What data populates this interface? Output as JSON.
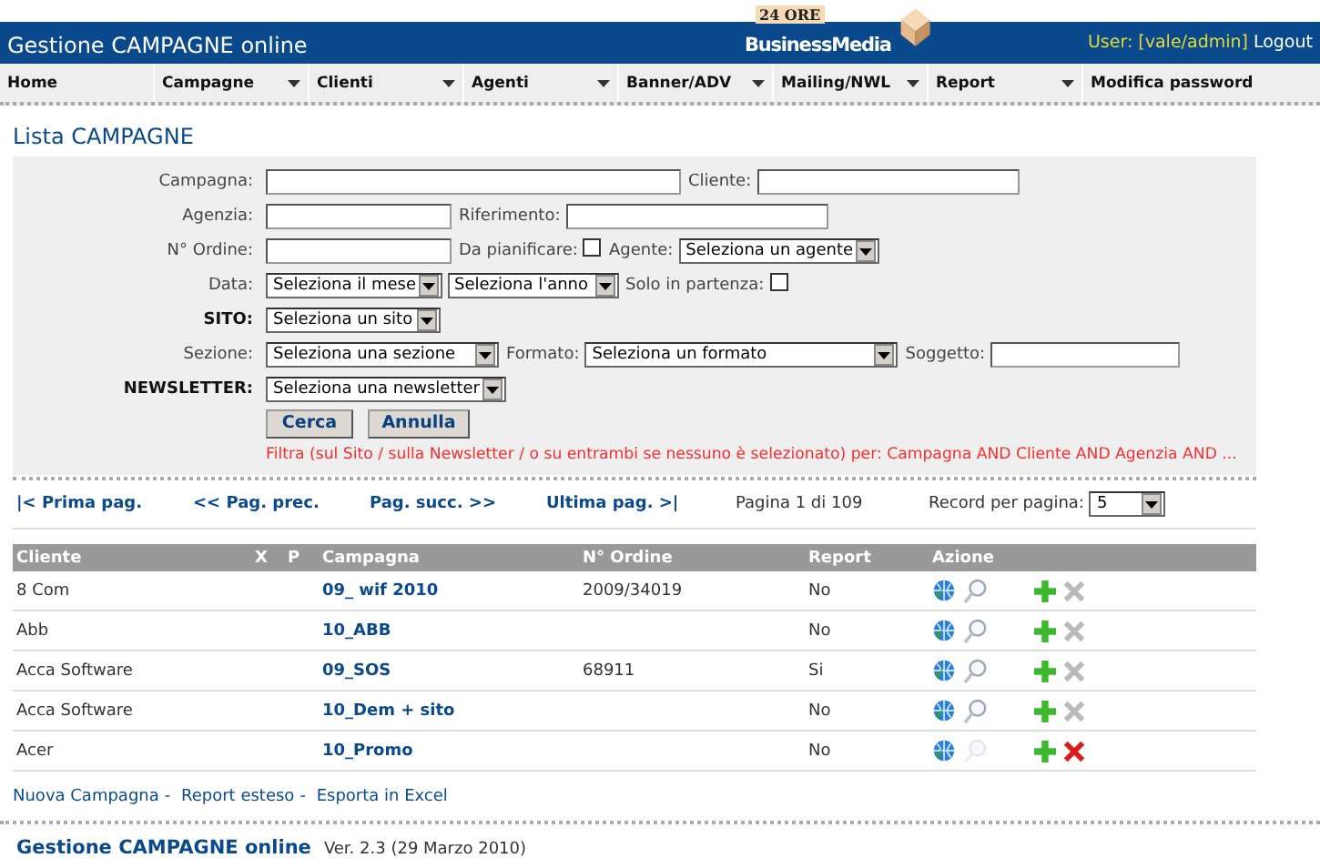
{
  "header": {
    "title": "Gestione CAMPAGNE online",
    "logo_top": "24 ORE",
    "logo_bottom": "BusinessMedia",
    "user_label": "User:",
    "user": "[vale/admin]",
    "logout": "Logout"
  },
  "menu": [
    {
      "label": "Home",
      "dropdown": false
    },
    {
      "label": "Campagne",
      "dropdown": true
    },
    {
      "label": "Clienti",
      "dropdown": true
    },
    {
      "label": "Agenti",
      "dropdown": true
    },
    {
      "label": "Banner/ADV",
      "dropdown": true
    },
    {
      "label": "Mailing/NWL",
      "dropdown": true
    },
    {
      "label": "Report",
      "dropdown": true
    },
    {
      "label": "Modifica password",
      "dropdown": false
    }
  ],
  "page_title": "Lista CAMPAGNE",
  "form": {
    "rows": [
      {
        "label": "Campagna:",
        "bold": false,
        "items": [
          {
            "kind": "input"
          },
          {
            "kind": "text",
            "text": "Cliente:"
          },
          {
            "kind": "input"
          }
        ]
      },
      {
        "label": "Agenzia:",
        "bold": false,
        "items": [
          {
            "kind": "input"
          },
          {
            "kind": "text",
            "text": "Riferimento:"
          },
          {
            "kind": "input"
          }
        ]
      },
      {
        "label": "N° Ordine:",
        "bold": false,
        "items": [
          {
            "kind": "input"
          },
          {
            "kind": "text",
            "text": "Da pianificare:"
          },
          {
            "kind": "checkbox",
            "checked": false
          },
          {
            "kind": "text",
            "text": "Agente:"
          },
          {
            "kind": "select",
            "value": "Seleziona un agente"
          }
        ]
      },
      {
        "label": "Data:",
        "bold": false,
        "items": [
          {
            "kind": "select",
            "value": "Seleziona il mese"
          },
          {
            "kind": "select",
            "value": "Seleziona l'anno"
          },
          {
            "kind": "text",
            "text": "Solo in partenza:"
          },
          {
            "kind": "checkbox",
            "checked": false
          }
        ]
      },
      {
        "label": "SITO:",
        "bold": true,
        "items": [
          {
            "kind": "select",
            "value": "Seleziona un sito"
          }
        ]
      },
      {
        "label": "Sezione:",
        "bold": false,
        "items": [
          {
            "kind": "select",
            "value": "Seleziona una sezione"
          },
          {
            "kind": "text",
            "text": "Formato:"
          },
          {
            "kind": "select",
            "value": "Seleziona un formato"
          },
          {
            "kind": "text",
            "text": "Soggetto:"
          },
          {
            "kind": "input"
          }
        ]
      },
      {
        "label": "NEWSLETTER:",
        "bold": true,
        "items": [
          {
            "kind": "select",
            "value": "Seleziona una newsletter"
          }
        ]
      }
    ],
    "buttons": [
      "Cerca",
      "Annulla"
    ],
    "filter_note": "Filtra (sul Sito / sulla Newsletter / o su entrambi se nessuno è selezionato) per: Campagna AND Cliente AND Agenzia AND ..."
  },
  "pager": {
    "links": [
      "|< Prima pag.",
      "<< Pag. prec.",
      "Pag. succ. >>",
      "Ultima pag. >|"
    ],
    "info": "Pagina 1 di 109",
    "per_page_label": "Record per pagina:",
    "per_page": "5"
  },
  "table": {
    "columns": [
      "Cliente",
      "X",
      "P",
      "Campagna",
      "N° Ordine",
      "Report",
      "Azione"
    ],
    "rows": [
      {
        "cliente": "8 Com",
        "campagna": "09_ wif 2010",
        "ordine": "2009/34019",
        "report": "No",
        "viewable": true,
        "deletable": false
      },
      {
        "cliente": "Abb",
        "campagna": "10_ABB",
        "report": "No",
        "viewable": true,
        "deletable": false
      },
      {
        "cliente": "Acca Software",
        "campagna": "09_SOS",
        "ordine": "68911",
        "report": "Si",
        "viewable": true,
        "deletable": false
      },
      {
        "cliente": "Acca Software",
        "campagna": "10_Dem + sito",
        "report": "No",
        "viewable": true,
        "deletable": false
      },
      {
        "cliente": "Acer",
        "campagna": "10_Promo",
        "report": "No",
        "viewable": false,
        "deletable": true
      }
    ]
  },
  "actions": {
    "links": [
      "Nuova Campagna",
      "Report esteso",
      "Esporta in Excel"
    ],
    "separator": "-"
  },
  "footer": {
    "app_name": "Gestione CAMPAGNE online",
    "version": "Ver. 2.3 (29 Marzo 2010)"
  }
}
